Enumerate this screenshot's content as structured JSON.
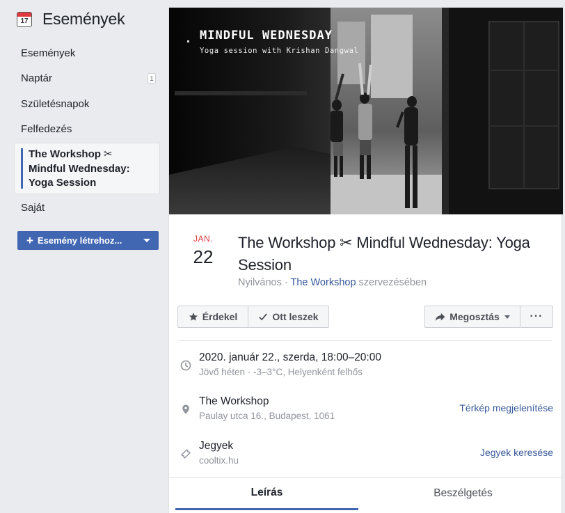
{
  "sidebar": {
    "icon": "calendar-icon",
    "icon_number": "17",
    "title": "Események",
    "items": [
      {
        "label": "Események"
      },
      {
        "label": "Naptár",
        "badge": "1"
      },
      {
        "label": "Születésnapok"
      },
      {
        "label": "Felfedezés"
      },
      {
        "label": "The Workshop ✂ Mindful Wednesday: Yoga Session",
        "active": true
      },
      {
        "label": "Saját"
      }
    ],
    "create_button": "Esemény létrehoz..."
  },
  "cover": {
    "title": "MINDFUL WEDNESDAY",
    "subtitle": "Yoga session with Krishan Dangwal"
  },
  "event": {
    "month": "JAN.",
    "day": "22",
    "title": "The Workshop ✂ Mindful Wednesday: Yoga Session",
    "visibility": "Nyilvános · ",
    "host": "The Workshop",
    "host_suffix": " szervezésében"
  },
  "actions": {
    "interested": "Érdekel",
    "going": "Ott leszek",
    "share": "Megosztás",
    "more": "···"
  },
  "details": {
    "datetime": {
      "icon": "clock-icon",
      "main": "2020. január 22., szerda, 18:00–20:00",
      "sub": "Jövő héten · -3–3°C, Helyenként felhős"
    },
    "location": {
      "icon": "location-pin-icon",
      "main": "The Workshop",
      "sub": "Paulay utca 16., Budapest, 1061",
      "link": "Térkép megjelenítése"
    },
    "tickets": {
      "icon": "ticket-icon",
      "main": "Jegyek",
      "sub": "cooltix.hu",
      "link": "Jegyek keresése"
    }
  },
  "tabs": {
    "description": "Leírás",
    "discussion": "Beszélgetés"
  },
  "colors": {
    "accent": "#4267b2",
    "link": "#365899",
    "date_red": "#e0393e",
    "background": "#e9ebee"
  }
}
